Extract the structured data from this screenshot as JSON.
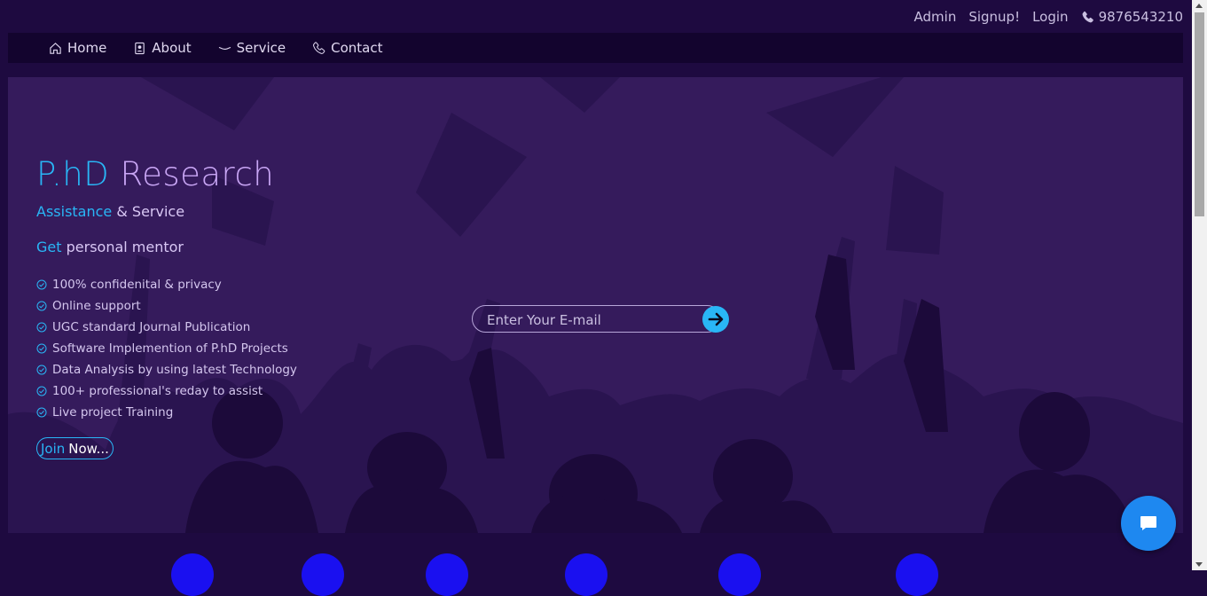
{
  "topbar": {
    "admin": "Admin",
    "signup": "Signup!",
    "login": "Login",
    "phone": "9876543210"
  },
  "nav": {
    "items": [
      {
        "label": "Home",
        "icon": "home-icon"
      },
      {
        "label": "About",
        "icon": "person-badge-icon"
      },
      {
        "label": "Service",
        "icon": "wave-icon"
      },
      {
        "label": "Contact",
        "icon": "phone-icon"
      }
    ]
  },
  "hero": {
    "title_part1": "P.hD",
    "title_part2": "Research",
    "line1_a": "Assistance",
    "line1_b": "& Service",
    "line2_a": "Get",
    "line2_b": "personal mentor",
    "features": [
      "100% confidenital & privacy",
      "Online support",
      "UGC standard Journal Publication",
      "Software Implemention of P.hD Projects",
      "Data Analysis by using latest Technology",
      "100+ professional's reday to assist",
      "Live project Training"
    ],
    "join_a": "Join",
    "join_b": "Now...",
    "email_placeholder": "Enter Your E-mail"
  },
  "colors": {
    "background": "#1e0a40",
    "hero_bg": "#351b5c",
    "accent": "#29b6f6",
    "lilac": "#c9a6f5",
    "chat": "#1e88f0"
  }
}
